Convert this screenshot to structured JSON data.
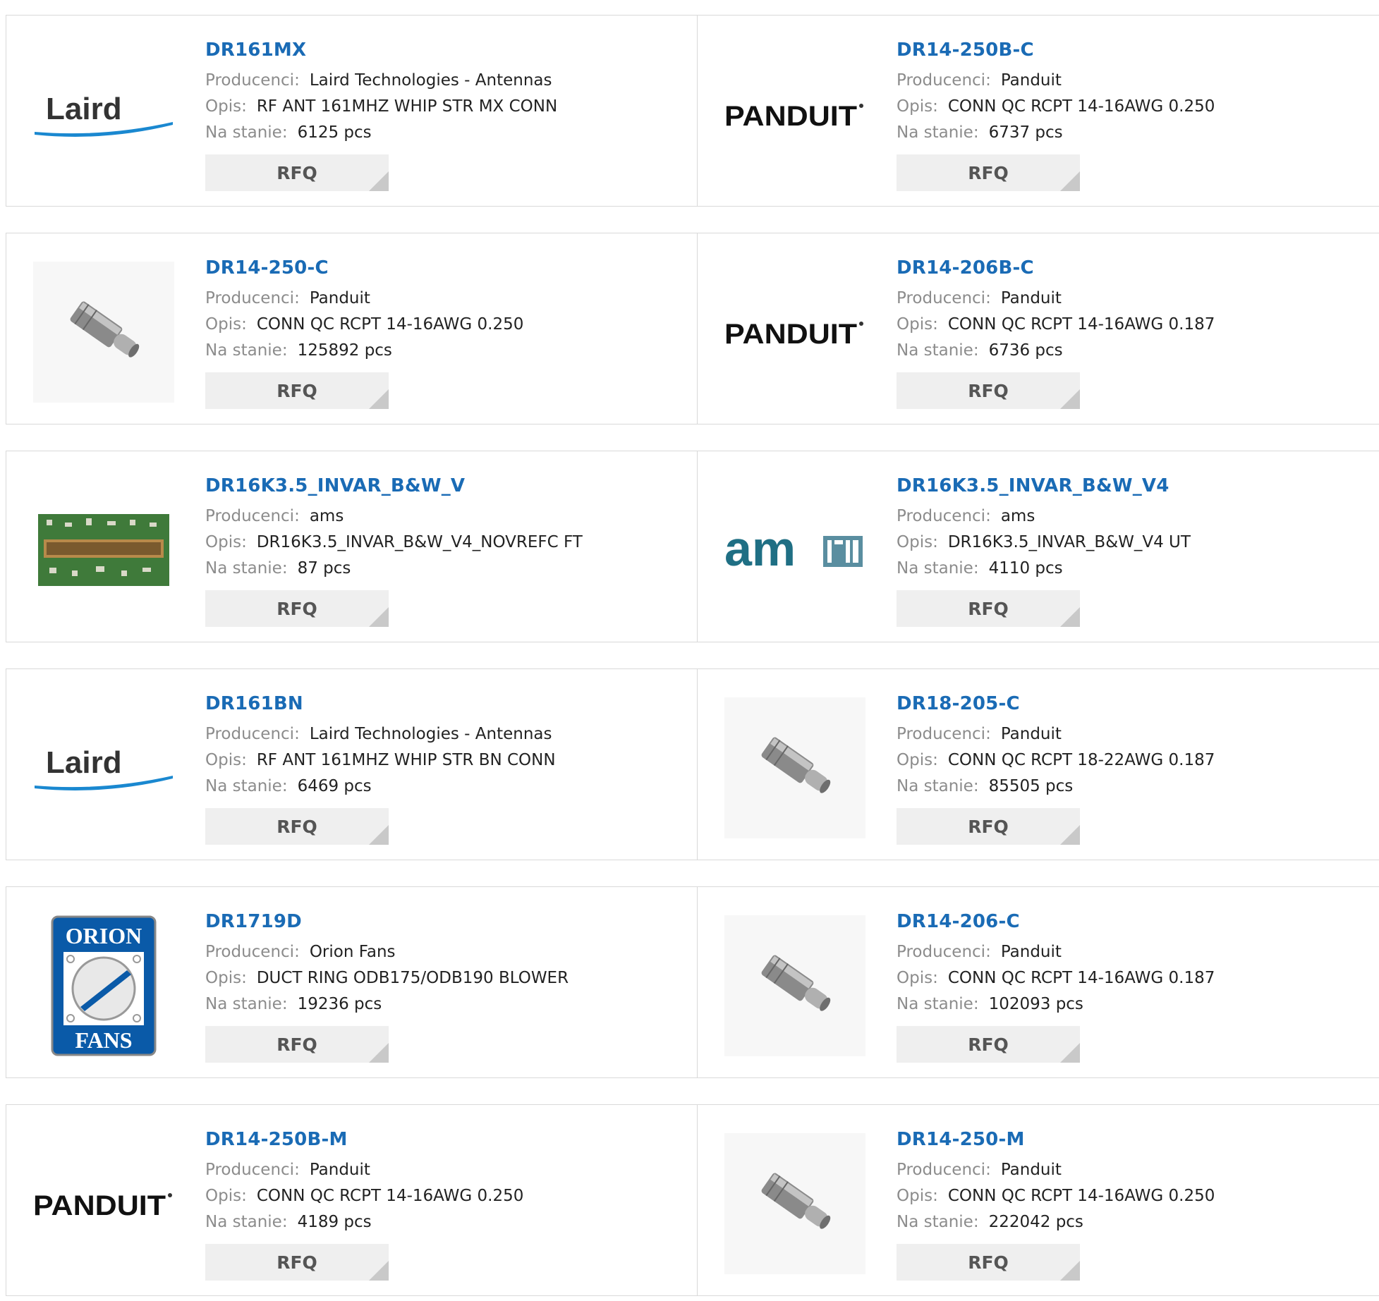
{
  "labels": {
    "manufacturer": "Producenci:",
    "description": "Opis:",
    "stock": "Na stanie:",
    "rfq": "RFQ"
  },
  "rows": [
    {
      "left": {
        "pn": "DR161MX",
        "manufacturer": "Laird Technologies - Antennas",
        "description": "RF ANT 161MHZ WHIP STR MX CONN",
        "stock": "6125 pcs",
        "logo": "laird-logo"
      },
      "right": {
        "pn": "DR14-250B-C",
        "manufacturer": "Panduit",
        "description": "CONN QC RCPT 14-16AWG 0.250",
        "stock": "6737 pcs",
        "logo": "panduit-logo"
      }
    },
    {
      "left": {
        "pn": "DR14-250-C",
        "manufacturer": "Panduit",
        "description": "CONN QC RCPT 14-16AWG 0.250",
        "stock": "125892 pcs",
        "logo": "connector-photo"
      },
      "right": {
        "pn": "DR14-206B-C",
        "manufacturer": "Panduit",
        "description": "CONN QC RCPT 14-16AWG 0.187",
        "stock": "6736 pcs",
        "logo": "panduit-logo"
      }
    },
    {
      "left": {
        "pn": "DR16K3.5_INVAR_B&W_V",
        "manufacturer": "ams",
        "description": "DR16K3.5_INVAR_B&W_V4_NOVREFC FT",
        "stock": "87 pcs",
        "logo": "sensor-board-photo"
      },
      "right": {
        "pn": "DR16K3.5_INVAR_B&W_V4",
        "manufacturer": "ams",
        "description": "DR16K3.5_INVAR_B&W_V4 UT",
        "stock": "4110 pcs",
        "logo": "ams-logo"
      }
    },
    {
      "left": {
        "pn": "DR161BN",
        "manufacturer": "Laird Technologies - Antennas",
        "description": "RF ANT 161MHZ WHIP STR BN CONN",
        "stock": "6469 pcs",
        "logo": "laird-logo"
      },
      "right": {
        "pn": "DR18-205-C",
        "manufacturer": "Panduit",
        "description": "CONN QC RCPT 18-22AWG 0.187",
        "stock": "85505 pcs",
        "logo": "connector-photo"
      }
    },
    {
      "left": {
        "pn": "DR1719D",
        "manufacturer": "Orion Fans",
        "description": "DUCT RING ODB175/ODB190 BLOWER",
        "stock": "19236 pcs",
        "logo": "orion-fans-logo"
      },
      "right": {
        "pn": "DR14-206-C",
        "manufacturer": "Panduit",
        "description": "CONN QC RCPT 14-16AWG 0.187",
        "stock": "102093 pcs",
        "logo": "connector-photo"
      }
    },
    {
      "left": {
        "pn": "DR14-250B-M",
        "manufacturer": "Panduit",
        "description": "CONN QC RCPT 14-16AWG 0.250",
        "stock": "4189 pcs",
        "logo": "panduit-logo"
      },
      "right": {
        "pn": "DR14-250-M",
        "manufacturer": "Panduit",
        "description": "CONN QC RCPT 14-16AWG 0.250",
        "stock": "222042 pcs",
        "logo": "connector-photo"
      }
    }
  ],
  "logo_text": {
    "laird": "Laird",
    "panduit": "PANDUIT",
    "ams": "am",
    "orion_top": "ORION",
    "orion_bottom": "FANS"
  },
  "colors": {
    "link": "#1a6bb5",
    "label": "#8c8c8c",
    "button_bg": "#efefef",
    "border": "#d9d9d9",
    "orion_blue": "#0a5aa8",
    "ams_teal": "#1f6f84"
  }
}
